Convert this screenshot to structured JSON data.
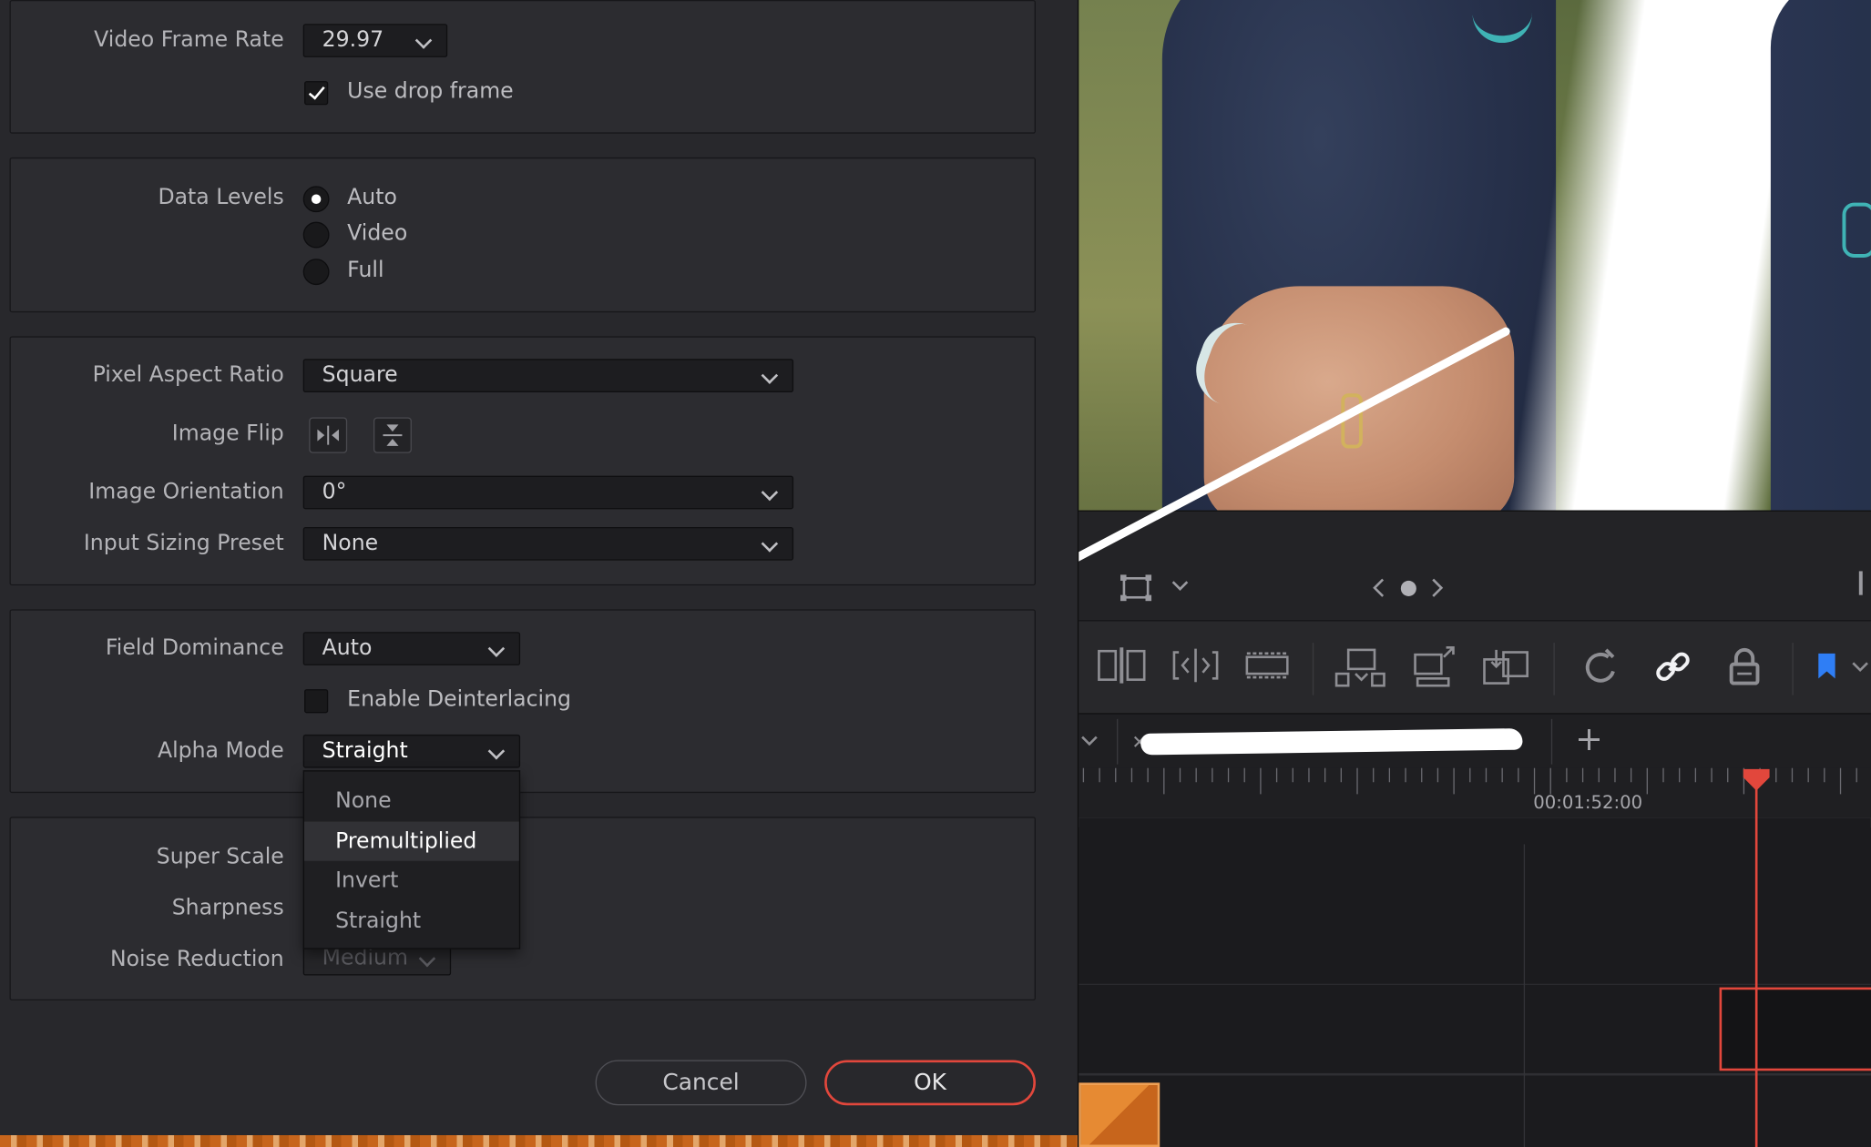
{
  "dialog": {
    "video_frame_rate": {
      "label": "Video Frame Rate",
      "value": "29.97"
    },
    "use_drop_frame": {
      "label": "Use drop frame",
      "checked": true
    },
    "data_levels": {
      "label": "Data Levels",
      "options": [
        "Auto",
        "Video",
        "Full"
      ],
      "selected": "Auto"
    },
    "pixel_aspect_ratio": {
      "label": "Pixel Aspect Ratio",
      "value": "Square"
    },
    "image_flip": {
      "label": "Image Flip"
    },
    "image_orientation": {
      "label": "Image Orientation",
      "value": "0°"
    },
    "input_sizing_preset": {
      "label": "Input Sizing Preset",
      "value": "None"
    },
    "field_dominance": {
      "label": "Field Dominance",
      "value": "Auto"
    },
    "enable_deinterlacing": {
      "label": "Enable Deinterlacing",
      "checked": false
    },
    "alpha_mode": {
      "label": "Alpha Mode",
      "value": "Straight",
      "options": [
        "None",
        "Premultiplied",
        "Invert",
        "Straight"
      ],
      "highlighted": "Premultiplied"
    },
    "super_scale": {
      "label": "Super Scale"
    },
    "sharpness": {
      "label": "Sharpness"
    },
    "noise_reduction": {
      "label": "Noise Reduction",
      "value": "Medium"
    },
    "cancel_label": "Cancel",
    "ok_label": "OK"
  },
  "timeline": {
    "timecode": "00:01:52:00",
    "add_tab_glyph": "+"
  },
  "colors": {
    "accent_red": "#e2473c",
    "flag_blue": "#2f7ef5",
    "clip_orange": "#c7651c"
  }
}
